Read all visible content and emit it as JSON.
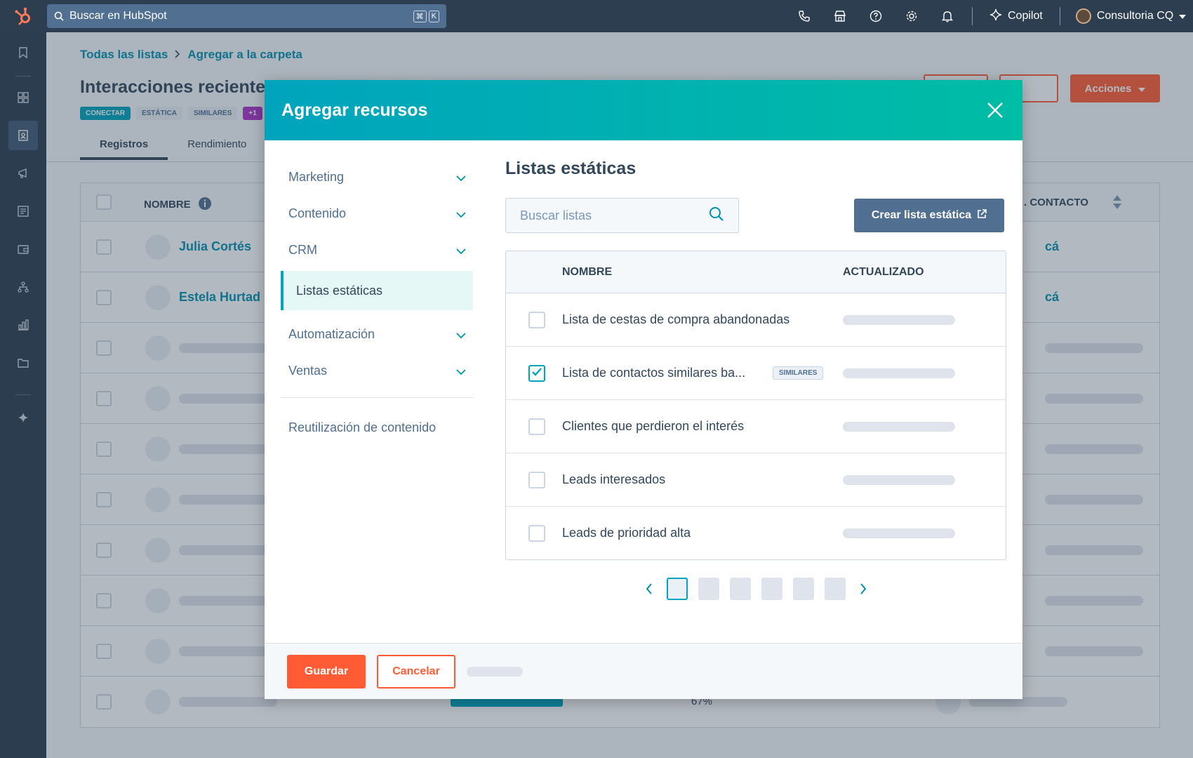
{
  "topbar": {
    "search_placeholder": "Buscar en HubSpot",
    "shortcut_keys": [
      "⌘",
      "K"
    ],
    "copilot_label": "Copilot",
    "account_name": "Consultoria CQ",
    "icons": [
      "phone-icon",
      "marketplace-icon",
      "help-icon",
      "settings-icon",
      "notifications-icon"
    ]
  },
  "sidebar": {
    "icons": [
      "bookmark-icon",
      "workspaces-icon",
      "contacts-icon",
      "marketing-icon",
      "content-icon",
      "commerce-icon",
      "automation-icon",
      "reporting-icon",
      "library-icon",
      "ai-spark-icon"
    ]
  },
  "page": {
    "breadcrumb_root": "Todas las listas",
    "breadcrumb_current": "Agregar a la carpeta",
    "title": "Interacciones reciente",
    "tags": [
      "CONECTAR",
      "ESTÁTICA",
      "SIMILARES",
      "+1"
    ],
    "actions_label": "Acciones",
    "tabs": [
      "Registros",
      "Rendimiento"
    ],
    "table": {
      "col_name": "NOMBRE",
      "col_contact": ". CONTACTO",
      "rows": [
        {
          "name": "Julia Cortés",
          "contact": "cá"
        },
        {
          "name": "Estela Hurtad",
          "contact": "cá"
        }
      ],
      "progress_label": "67%"
    }
  },
  "modal": {
    "title": "Agregar recursos",
    "nav": [
      {
        "label": "Marketing",
        "expandable": true
      },
      {
        "label": "Contenido",
        "expandable": true
      },
      {
        "label": "CRM",
        "expandable": true
      },
      {
        "label": "Listas estáticas",
        "expandable": false,
        "active": true
      },
      {
        "label": "Automatización",
        "expandable": true
      },
      {
        "label": "Ventas",
        "expandable": true
      }
    ],
    "nav_footer": "Reutilización de contenido",
    "content_title": "Listas estáticas",
    "search_placeholder": "Buscar listas",
    "create_button": "Crear lista estática",
    "table": {
      "col_name": "NOMBRE",
      "col_updated": "ACTUALIZADO",
      "rows": [
        {
          "name": "Lista de cestas de compra abandonadas",
          "checked": false,
          "badge": ""
        },
        {
          "name": "Lista de contactos similares ba...",
          "checked": true,
          "badge": "SIMILARES"
        },
        {
          "name": "Clientes que perdieron el interés",
          "checked": false,
          "badge": ""
        },
        {
          "name": "Leads interesados",
          "checked": false,
          "badge": ""
        },
        {
          "name": "Leads de prioridad alta",
          "checked": false,
          "badge": ""
        }
      ]
    },
    "pagination": {
      "pages": 6,
      "current": 1
    },
    "save_label": "Guardar",
    "cancel_label": "Cancelar"
  },
  "colors": {
    "accent_teal": "#00a4bd",
    "primary_orange": "#ff5c35",
    "nav_dark": "#2d3e50"
  }
}
